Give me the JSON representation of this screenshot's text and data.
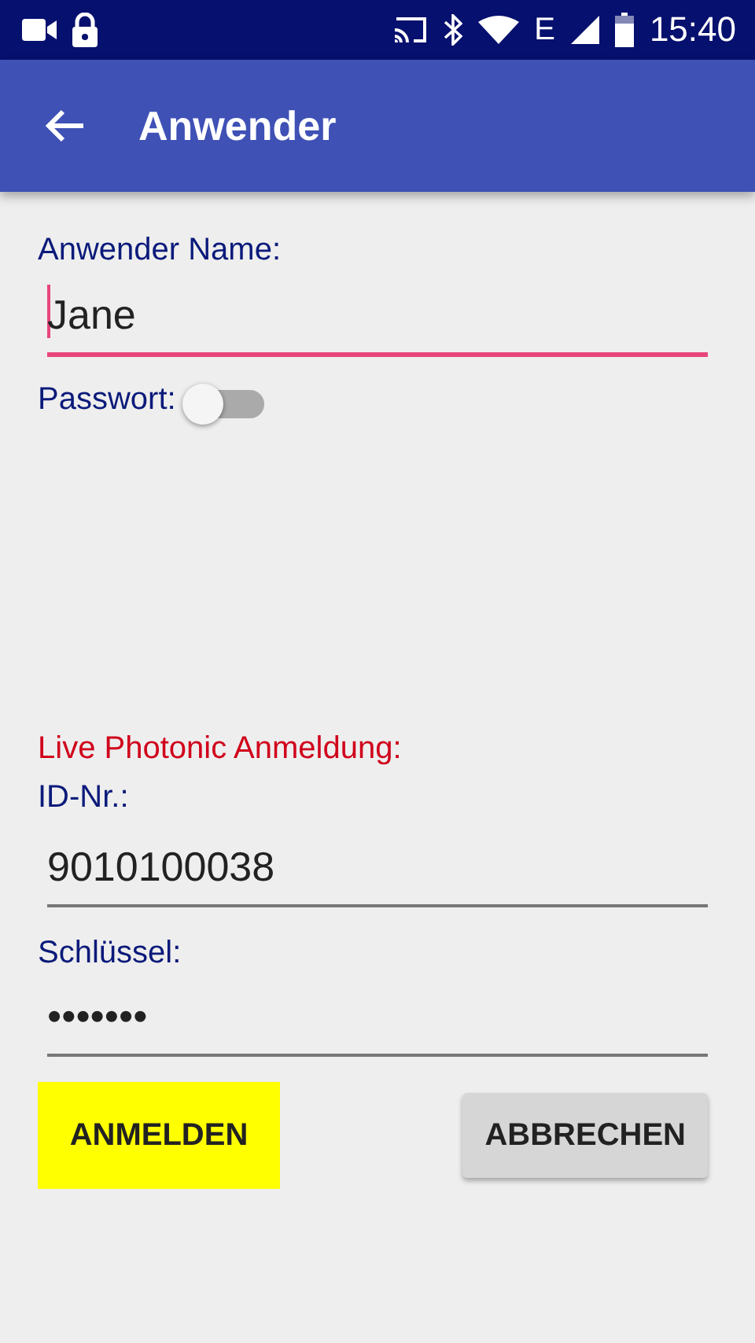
{
  "status_bar": {
    "time": "15:40",
    "network": "E"
  },
  "app_bar": {
    "title": "Anwender"
  },
  "user_name": {
    "label": "Anwender Name:",
    "value": "Jane",
    "focused": true
  },
  "password": {
    "label": "Passwort:",
    "on": false
  },
  "login_section": {
    "title": "Live Photonic Anmeldung:"
  },
  "id_field": {
    "label": "ID-Nr.:",
    "value": "9010100038",
    "focused": false
  },
  "key_field": {
    "label": "Schlüssel:",
    "value": "•••••••",
    "focused": false
  },
  "buttons": [
    {
      "label": "ANMELDEN",
      "kind": "primary"
    },
    {
      "label": "ABBRECHEN",
      "kind": "secondary"
    }
  ]
}
